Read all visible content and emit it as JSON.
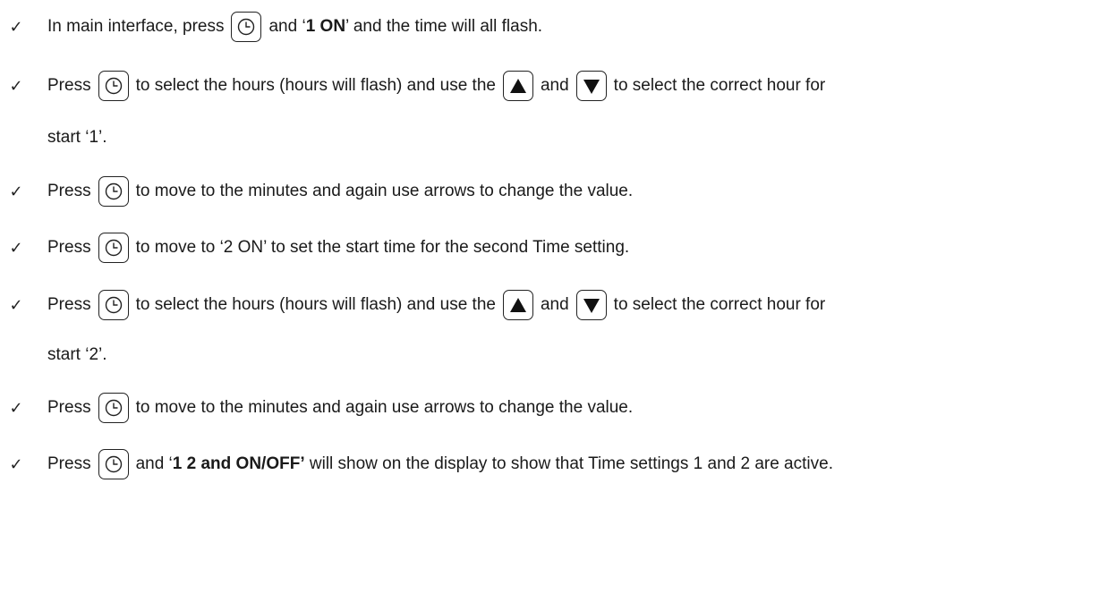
{
  "check_icon": "✓",
  "icons": {
    "clock": "clock-icon",
    "up": "up-arrow-icon",
    "down": "down-arrow-icon"
  },
  "steps": [
    {
      "a": "In main interface, press",
      "b": "and ‘",
      "c": "1 ",
      "d": "ON",
      "e": "’ and the time will all flash."
    },
    {
      "a": "Press",
      "b": "to select the hours (hours will flash) and use the",
      "c": "and",
      "d": "to select the correct hour for",
      "cont": "start ‘1’."
    },
    {
      "a": "Press",
      "b": "to move to the minutes and again use arrows to change the value."
    },
    {
      "a": "Press",
      "b": "to move to ‘2 ON’ to set the start time for the second Time setting."
    },
    {
      "a": "Press",
      "b": "to select the hours (hours will flash) and use the",
      "c": "and",
      "d": "to select the correct hour for",
      "cont": "start ‘2’."
    },
    {
      "a": "Press",
      "b": "to move to the minutes and again use arrows to change the value."
    },
    {
      "a": "Press",
      "b": "and ‘",
      "c": "1 2",
      "d": " and ",
      "e": "ON/OFF’",
      "f": " will show on the display to show that Time settings 1 and 2 are active."
    }
  ]
}
